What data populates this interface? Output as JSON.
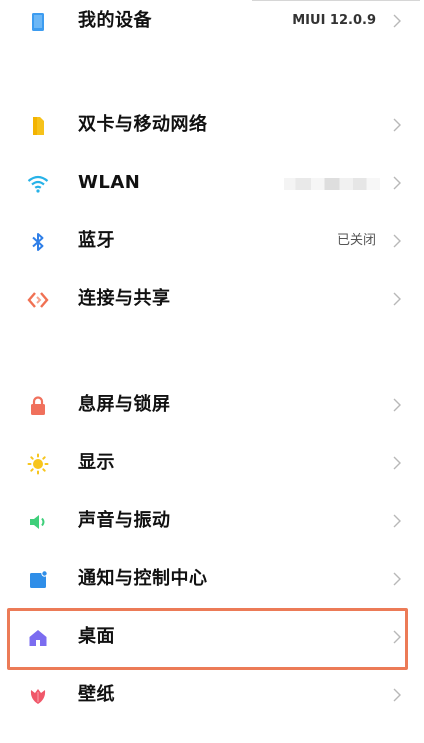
{
  "groups": [
    {
      "items": [
        {
          "label": "我的设备",
          "value": "MIUI 12.0.9",
          "icon": "phone-icon",
          "color": "#3d9cf0"
        }
      ]
    },
    {
      "items": [
        {
          "label": "双卡与移动网络",
          "value": "",
          "icon": "sim-card-icon",
          "color": "#f6c21a"
        },
        {
          "label": "WLAN",
          "value": "",
          "icon": "wifi-icon",
          "color": "#27b2e8"
        },
        {
          "label": "蓝牙",
          "value": "已关闭",
          "icon": "bluetooth-icon",
          "color": "#2f7fe8"
        },
        {
          "label": "连接与共享",
          "value": "",
          "icon": "connection-share-icon",
          "color": "#f07153"
        }
      ]
    },
    {
      "items": [
        {
          "label": "息屏与锁屏",
          "value": "",
          "icon": "lock-icon",
          "color": "#f0705c"
        },
        {
          "label": "显示",
          "value": "",
          "icon": "sun-icon",
          "color": "#f7c51c"
        },
        {
          "label": "声音与振动",
          "value": "",
          "icon": "speaker-icon",
          "color": "#3ecf7a"
        },
        {
          "label": "通知与控制中心",
          "value": "",
          "icon": "notification-icon",
          "color": "#2f8ee8"
        },
        {
          "label": "桌面",
          "value": "",
          "icon": "home-icon",
          "color": "#7b6cf0"
        },
        {
          "label": "壁纸",
          "value": "",
          "icon": "wallpaper-flower-icon",
          "color": "#f0586a"
        }
      ]
    }
  ],
  "highlight_color": "#ec7b57"
}
